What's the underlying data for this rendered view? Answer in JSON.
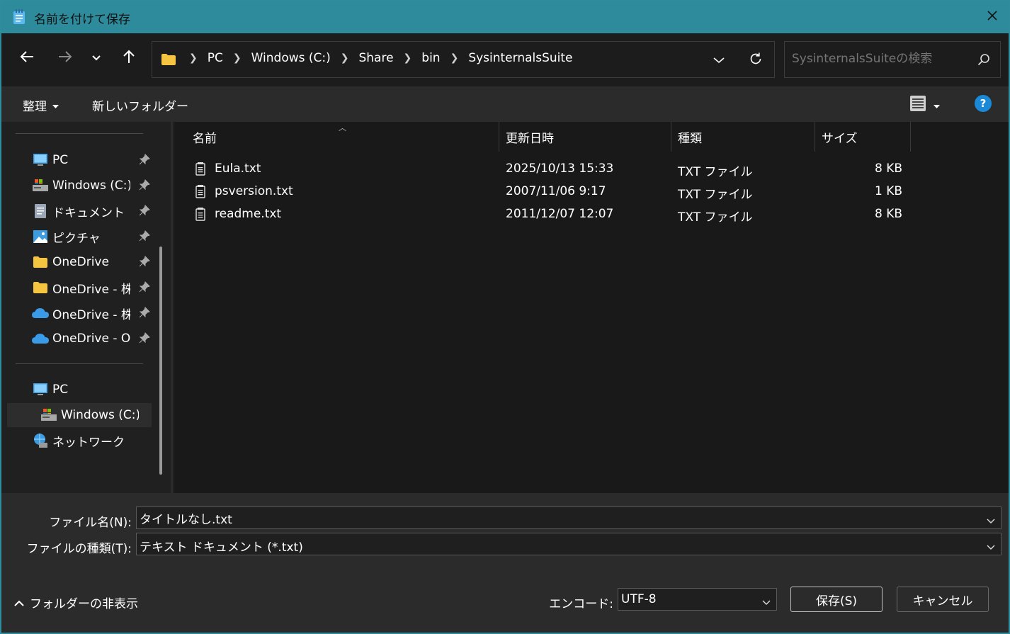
{
  "window": {
    "title": "名前を付けて保存"
  },
  "address": {
    "crumbs": [
      "PC",
      "Windows (C:)",
      "Share",
      "bin",
      "SysinternalsSuite"
    ]
  },
  "search": {
    "placeholder": "SysinternalsSuiteの検索"
  },
  "commandbar": {
    "organize": "整理",
    "new_folder": "新しいフォルダー"
  },
  "sidebar": {
    "quick": [
      {
        "label": "PC",
        "icon": "monitor-icon",
        "pinned": true
      },
      {
        "label": "Windows (C:)",
        "icon": "drive-icon",
        "pinned": true
      },
      {
        "label": "ドキュメント",
        "icon": "document-icon",
        "pinned": true
      },
      {
        "label": "ピクチャ",
        "icon": "pictures-icon",
        "pinned": true
      },
      {
        "label": "OneDrive",
        "icon": "folder-icon",
        "pinned": true
      },
      {
        "label": "OneDrive - 株式",
        "icon": "folder-icon",
        "pinned": true
      },
      {
        "label": "OneDrive - 株式",
        "icon": "cloud-icon",
        "pinned": true
      },
      {
        "label": "OneDrive - Off",
        "icon": "cloud-icon",
        "pinned": true
      }
    ],
    "tree": [
      {
        "label": "PC",
        "icon": "monitor-icon",
        "indent": false,
        "selected": false
      },
      {
        "label": "Windows (C:)",
        "icon": "drive-icon",
        "indent": true,
        "selected": true
      },
      {
        "label": "ネットワーク",
        "icon": "network-icon",
        "indent": false,
        "selected": false
      }
    ]
  },
  "filelist": {
    "columns": [
      "名前",
      "更新日時",
      "種類",
      "サイズ"
    ],
    "rows": [
      {
        "name": "Eula.txt",
        "modified": "2025/10/13 15:33",
        "type": "TXT ファイル",
        "size": "8 KB"
      },
      {
        "name": "psversion.txt",
        "modified": "2007/11/06 9:17",
        "type": "TXT ファイル",
        "size": "1 KB"
      },
      {
        "name": "readme.txt",
        "modified": "2011/12/07 12:07",
        "type": "TXT ファイル",
        "size": "8 KB"
      }
    ]
  },
  "footer": {
    "filename_label": "ファイル名(N):",
    "filename_value": "タイトルなし.txt",
    "filetype_label": "ファイルの種類(T):",
    "filetype_value": "テキスト ドキュメント (*.txt)",
    "encoding_label": "エンコード:",
    "encoding_value": "UTF-8",
    "hide_folders": "フォルダーの非表示",
    "save": "保存(S)",
    "cancel": "キャンセル"
  },
  "colors": {
    "titlebar": "#2e8b9b",
    "accent": "#1a8ad8",
    "folder": "#f5c542",
    "onedrive": "#3a9be8"
  }
}
